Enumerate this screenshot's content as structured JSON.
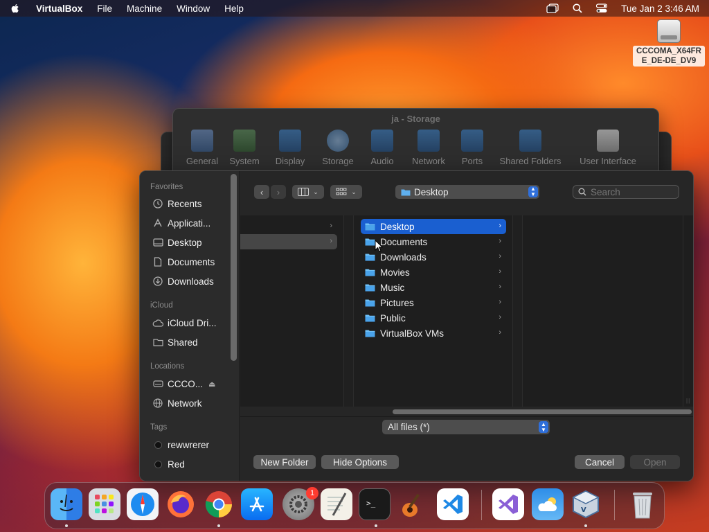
{
  "menubar": {
    "app": "VirtualBox",
    "items": [
      "File",
      "Machine",
      "Window",
      "Help"
    ],
    "clock": "Tue Jan 2  3:46 AM"
  },
  "desktop": {
    "disk_label": "CCCOMA_X64FRE_DE-DE_DV9"
  },
  "settings_window": {
    "title": "ja - Storage",
    "tools": [
      "General",
      "System",
      "Display",
      "Storage",
      "Audio",
      "Network",
      "Ports",
      "Shared Folders",
      "User Interface"
    ]
  },
  "dialog": {
    "sidebar": {
      "favorites_header": "Favorites",
      "favorites": [
        "Recents",
        "Applicati...",
        "Desktop",
        "Documents",
        "Downloads"
      ],
      "icloud_header": "iCloud",
      "icloud": [
        "iCloud Dri...",
        "Shared"
      ],
      "locations_header": "Locations",
      "locations": [
        "CCCO...",
        "Network"
      ],
      "tags_header": "Tags",
      "tags": [
        "rewwrerer",
        "Red"
      ]
    },
    "path_popup": "Desktop",
    "search_placeholder": "Search",
    "files": [
      "Desktop",
      "Documents",
      "Downloads",
      "Movies",
      "Music",
      "Pictures",
      "Public",
      "VirtualBox VMs"
    ],
    "selected_file": "Desktop",
    "filter": "All files (*)",
    "buttons": {
      "new_folder": "New Folder",
      "hide_options": "Hide Options",
      "cancel": "Cancel",
      "open": "Open"
    }
  },
  "dock": {
    "apps": [
      "Finder",
      "Launchpad",
      "Safari",
      "Firefox",
      "Chrome",
      "App Store",
      "System Settings",
      "TextEdit",
      "Terminal",
      "GarageBand",
      "Visual Studio Code",
      "Visual Studio",
      "Weather",
      "VirtualBox",
      "Trash"
    ],
    "settings_badge": "1"
  }
}
